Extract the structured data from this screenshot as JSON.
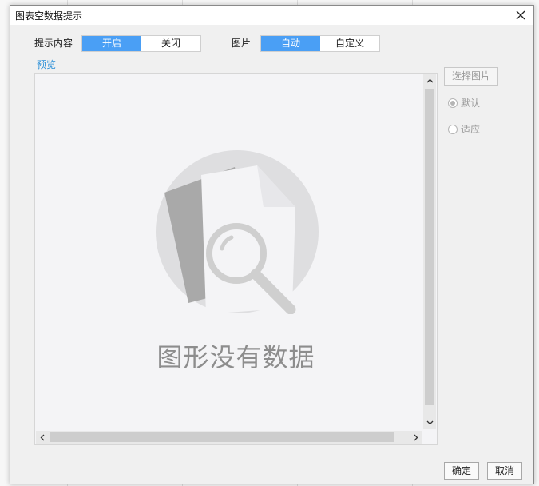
{
  "dialog": {
    "title": "图表空数据提示",
    "content_label": "提示内容",
    "content_options": [
      "开启",
      "关闭"
    ],
    "image_label": "图片",
    "image_options": [
      "自动",
      "自定义"
    ],
    "preview_label": "预览",
    "empty_message": "图形没有数据",
    "select_image_button": "选择图片",
    "radio_default": "默认",
    "radio_fit": "适应",
    "ok_button": "确定",
    "cancel_button": "取消",
    "accent_color": "#4a9ff5"
  }
}
